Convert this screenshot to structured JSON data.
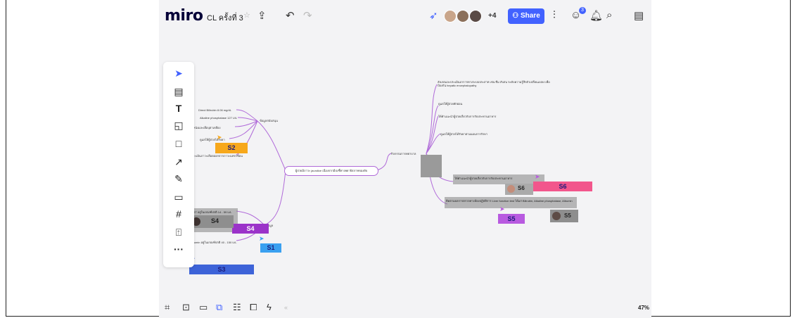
{
  "app": {
    "logo": "miro",
    "board_title": "CL ครั้งที่ 3",
    "star": "☆"
  },
  "topbar": {
    "more_count": "+4",
    "share_label": "Share",
    "notification_count": "3"
  },
  "mindmap": {
    "center": "ผู้ป่วยมีภาวะ jaundice เนื่องจากมีบ่งชี้ทางพยาธิสภาพของตับ",
    "branch_left": "ข้อมูลสนับสนุน",
    "branch_right": "กิจกรรมการพยาบาล",
    "branch_left_low": "ข้อมูล",
    "left_items": [
      "Direct Bilirubin 8.06 mg/dL",
      "Alkaline phosphatase 127 U/L",
      "ผิวหนังและเยื่อบุตาเหลือง",
      "ดูแลให้ผู้ป่วยได้รับยา",
      "ประเมินภาวะเลือดออกจากภาวะแทรกซ้อน"
    ],
    "right_items": [
      "สังเกตและประเมินอาการทางระบบประสาท เช่น ซึม สับสน ระดับความรู้สึกตัวเปลี่ยนแปลง เพื่อป้องกัน hepatic encephalopathy",
      "ดูแลให้ผู้ป่วยพักผ่อน",
      "ให้คำแนะนำผู้ป่วยเกี่ยวกับการรับประทานอาหาร",
      "ดูแลให้ผู้ป่วยได้รับยาตามแผนการรักษา"
    ],
    "box_right_1": "ให้คำแนะนำผู้ป่วยเกี่ยวกับการรับประทานอาหาร",
    "box_right_2": "ติดตามผลการตรวจทางห้องปฏิบัติการ Liver function test ได้แก่ Bilirubin, Alkaline phosphatase, Albumin",
    "box_left_1": "AST อยู่ในเกณฑ์ปกติ 14 - 59 U/L",
    "box_left_2": "ALT",
    "left_low_item": "Albumin อยู่ในเกณฑ์ปกติ 40 - 150 U/L"
  },
  "tags": {
    "s1": "S1",
    "s2": "S2",
    "s3": "S3",
    "s4a": "S4",
    "s4b": "S4",
    "s5a": "S5",
    "s5b": "S5",
    "s6a": "S6",
    "s6b": "S6"
  },
  "colors": {
    "brand_blue": "#4262ff",
    "purple_line": "#b06ad9",
    "sticky_orange": "#f7a81b",
    "sticky_blue": "#3d63d8",
    "sticky_pink": "#f2568c",
    "sticky_purple": "#9b33c9",
    "sticky_light_blue": "#3aa0f0"
  },
  "zoom": "47%"
}
